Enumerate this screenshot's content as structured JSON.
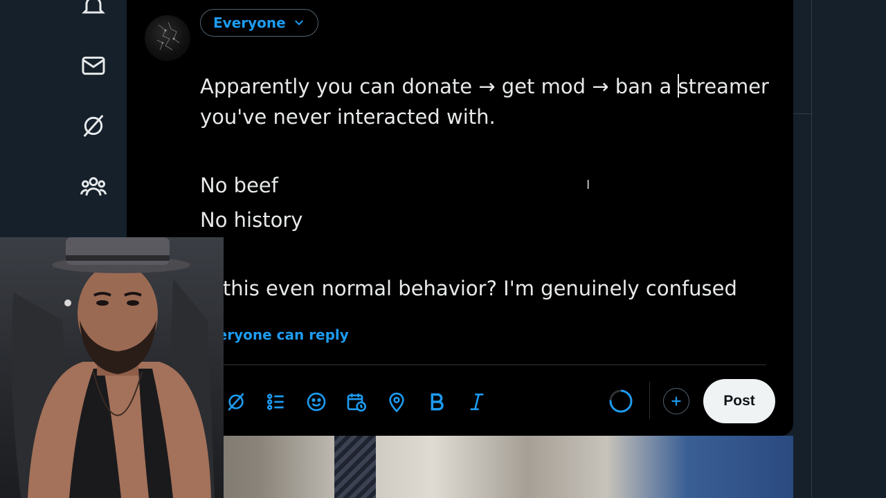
{
  "composer": {
    "audience_label": "Everyone",
    "text": {
      "line1_before_caret": "Apparently you can donate → get mod → ban a ",
      "line1_after_caret": "streamer",
      "line2": "you've never interacted with.",
      "line3": "No beef",
      "line4": "No history",
      "line5": "Is this even normal behavior? I'm genuinely confused"
    },
    "reply_setting_label": "Everyone can reply",
    "post_button_label": "Post"
  },
  "toolbar": {
    "icons": [
      "gif-icon",
      "list-icon",
      "emoji-icon",
      "schedule-icon",
      "location-icon",
      "bold-icon",
      "italic-icon"
    ]
  },
  "left_nav": {
    "icons": [
      "notifications-icon",
      "messages-icon",
      "grok-icon",
      "communities-icon"
    ]
  },
  "colors": {
    "accent": "#1d9bf0",
    "background": "#000000",
    "page": "#15202b",
    "text": "#e7e9ea"
  }
}
